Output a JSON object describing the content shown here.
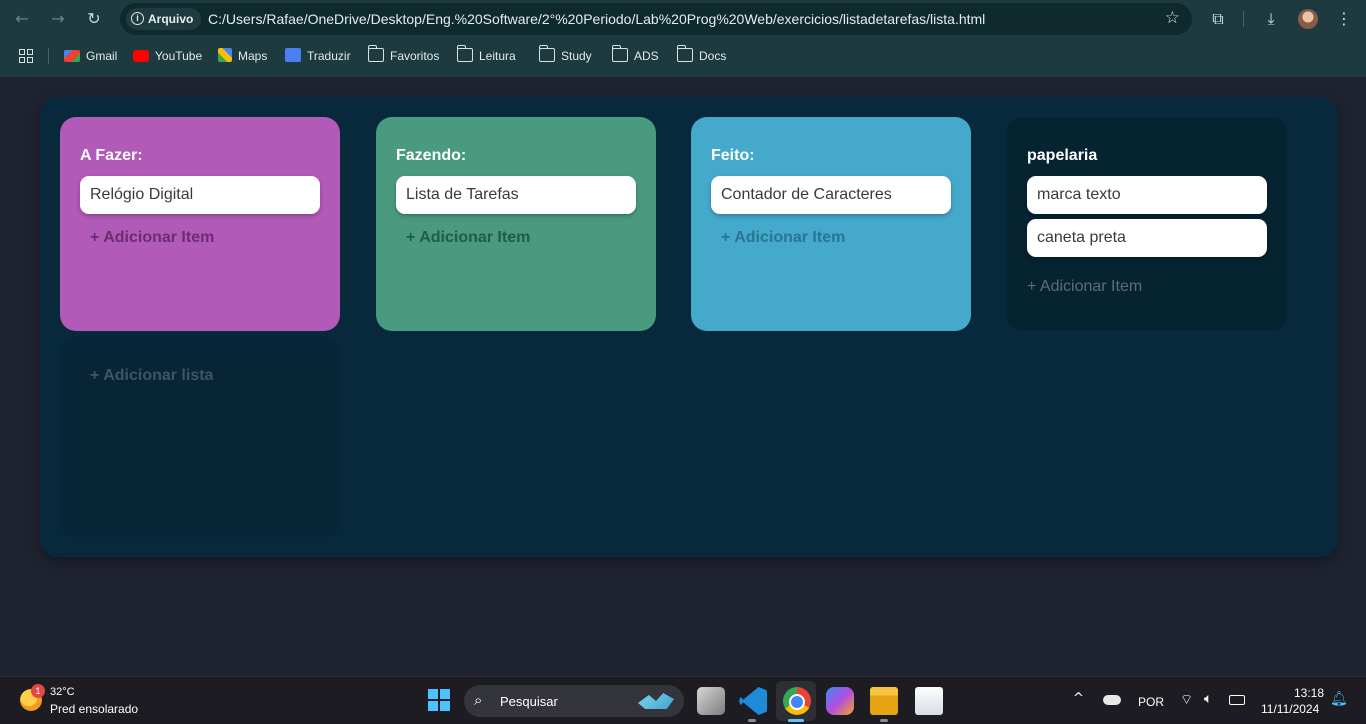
{
  "browser": {
    "site_chip": "Arquivo",
    "url": "C:/Users/Rafae/OneDrive/Desktop/Eng.%20Software/2°%20Periodo/Lab%20Prog%20Web/exercicios/listadetarefas/lista.html",
    "bookmarks": [
      {
        "label": "Gmail",
        "icon": "gmail-icon"
      },
      {
        "label": "YouTube",
        "icon": "youtube-icon"
      },
      {
        "label": "Maps",
        "icon": "maps-icon"
      },
      {
        "label": "Traduzir",
        "icon": "translate-icon"
      },
      {
        "label": "Favoritos",
        "icon": "folder-icon"
      },
      {
        "label": "Leitura",
        "icon": "folder-icon"
      },
      {
        "label": "Study",
        "icon": "folder-icon"
      },
      {
        "label": "ADS",
        "icon": "folder-icon"
      },
      {
        "label": "Docs",
        "icon": "folder-icon"
      }
    ]
  },
  "lists": [
    {
      "title": "A Fazer:",
      "color": "#b25ab8",
      "items": [
        "Relógio Digital"
      ],
      "add_label": "+ Adicionar Item",
      "add_color": "#6b2d72"
    },
    {
      "title": "Fazendo:",
      "color": "#4a9a7f",
      "items": [
        "Lista de Tarefas"
      ],
      "add_label": "+ Adicionar Item",
      "add_color": "#1f5d48"
    },
    {
      "title": "Feito:",
      "color": "#45a9cb",
      "items": [
        "Contador de Caracteres"
      ],
      "add_label": "+ Adicionar Item",
      "add_color": "#2a7596"
    },
    {
      "title": "papelaria",
      "color": "#062332",
      "items": [
        "marca texto",
        "caneta preta"
      ],
      "add_label": "+ Adicionar Item",
      "add_color": "#5e6d75"
    }
  ],
  "add_list": {
    "label": "+ Adicionar lista",
    "color": "#072536",
    "text_color": "#3f5560"
  },
  "taskbar": {
    "weather_badge": "1",
    "temperature": "32°C",
    "forecast": "Pred ensolarado",
    "search_placeholder": "Pesquisar",
    "language": "POR",
    "time": "13:18",
    "date": "11/11/2024"
  }
}
